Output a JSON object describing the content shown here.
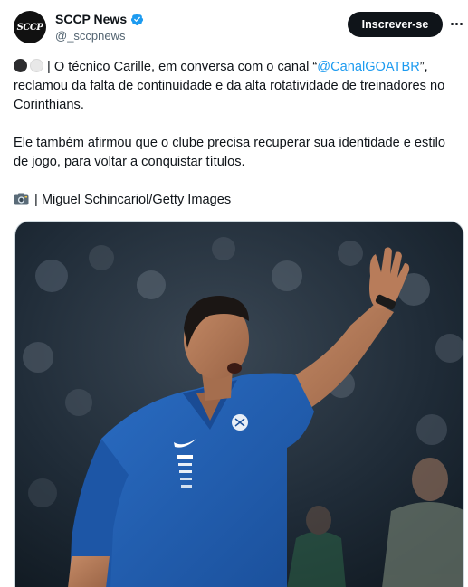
{
  "account": {
    "display_name": "SCCP News",
    "handle": "@_sccpnews",
    "avatar_text": "SCCP",
    "verified": true
  },
  "actions": {
    "subscribe_label": "Inscrever-se",
    "more_icon": "more-horizontal-icon"
  },
  "tweet": {
    "p1_prefix": " | O técnico Carille, em conversa com o canal “",
    "p1_mention": "@CanalGOATBR",
    "p1_suffix": "”, reclamou da falta de continuidade e da alta rotatividade de treinadores no Corinthians.",
    "p2": "Ele também afirmou que o clube precisa recuperar sua identidade e estilo de jogo, para voltar a conquistar títulos.",
    "credit": " | Miguel Schincariol/Getty Images",
    "emoji_icons": [
      "black-circle-icon",
      "white-circle-icon",
      "camera-icon"
    ]
  },
  "media": {
    "description_icon": "coach-photo",
    "shirt_color": "#1f5cb0",
    "background_color": "#1d2c3a"
  },
  "colors": {
    "accent": "#1d9bf0",
    "text": "#0f1419",
    "secondary_text": "#536471"
  }
}
